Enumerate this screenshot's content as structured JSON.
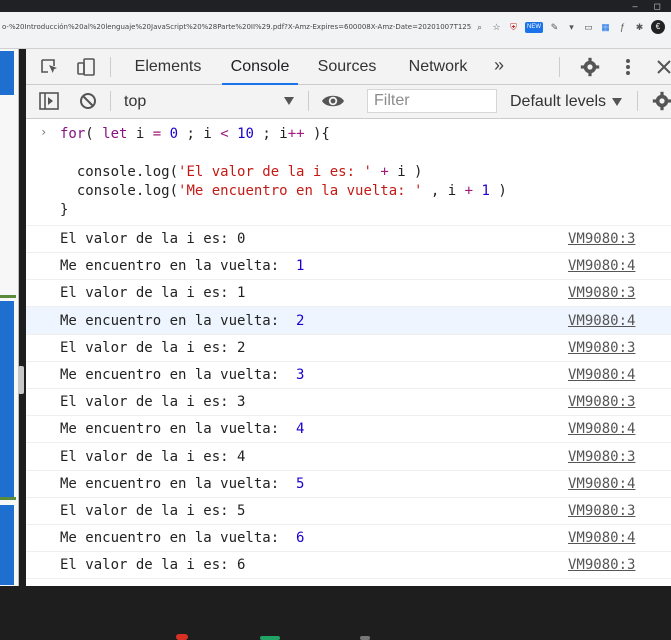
{
  "browser": {
    "url": "o-%20Introducción%20al%20lenguaje%20JavaScript%20%28Parte%20II%29.pdf?X-Amz-Expires=600008X-Amz-Date=20201007T1253322&X...",
    "window_controls": [
      "‒",
      "◻"
    ],
    "extension_badge": "NEW",
    "avatar_letter": "€"
  },
  "devtools": {
    "tabs": [
      "Elements",
      "Console",
      "Sources",
      "Network"
    ],
    "active_tab": "Console",
    "more_label": "»",
    "context": "top",
    "filter_placeholder": "Filter",
    "levels_label": "Default levels"
  },
  "console": {
    "prompt": "›",
    "code": {
      "for_kw": "for",
      "let_kw": "let",
      "var": "i",
      "zero": "0",
      "ten": "10",
      "one": "1",
      "str1": "'El valor de la i es: '",
      "str2": "'Me encuentro en la vuelta: '",
      "line2_prefix": "  console.log(",
      "line2_suffix": " i )",
      "line3_prefix": "  console.log(",
      "line3_suffix": " , i ",
      "line3_close": " )",
      "closing": "}"
    },
    "messages": [
      {
        "text": "El valor de la i es: 0",
        "num": "",
        "source": "VM9080:3"
      },
      {
        "text": "Me encuentro en la vuelta:  ",
        "num": "1",
        "source": "VM9080:4"
      },
      {
        "text": "El valor de la i es: 1",
        "num": "",
        "source": "VM9080:3"
      },
      {
        "text": "Me encuentro en la vuelta:  ",
        "num": "2",
        "source": "VM9080:4"
      },
      {
        "text": "El valor de la i es: 2",
        "num": "",
        "source": "VM9080:3"
      },
      {
        "text": "Me encuentro en la vuelta:  ",
        "num": "3",
        "source": "VM9080:4"
      },
      {
        "text": "El valor de la i es: 3",
        "num": "",
        "source": "VM9080:3"
      },
      {
        "text": "Me encuentro en la vuelta:  ",
        "num": "4",
        "source": "VM9080:4"
      },
      {
        "text": "El valor de la i es: 4",
        "num": "",
        "source": "VM9080:3"
      },
      {
        "text": "Me encuentro en la vuelta:  ",
        "num": "5",
        "source": "VM9080:4"
      },
      {
        "text": "El valor de la i es: 5",
        "num": "",
        "source": "VM9080:3"
      },
      {
        "text": "Me encuentro en la vuelta:  ",
        "num": "6",
        "source": "VM9080:4"
      },
      {
        "text": "El valor de la i es: 6",
        "num": "",
        "source": "VM9080:3"
      }
    ]
  },
  "taskbar": {
    "badge_count": "4"
  },
  "colors": {
    "keyword": "#881280",
    "number": "#1c00cf",
    "string": "#c41a16",
    "active_tab_underline": "#1a73e8",
    "hover_row": "#eff5ff"
  }
}
